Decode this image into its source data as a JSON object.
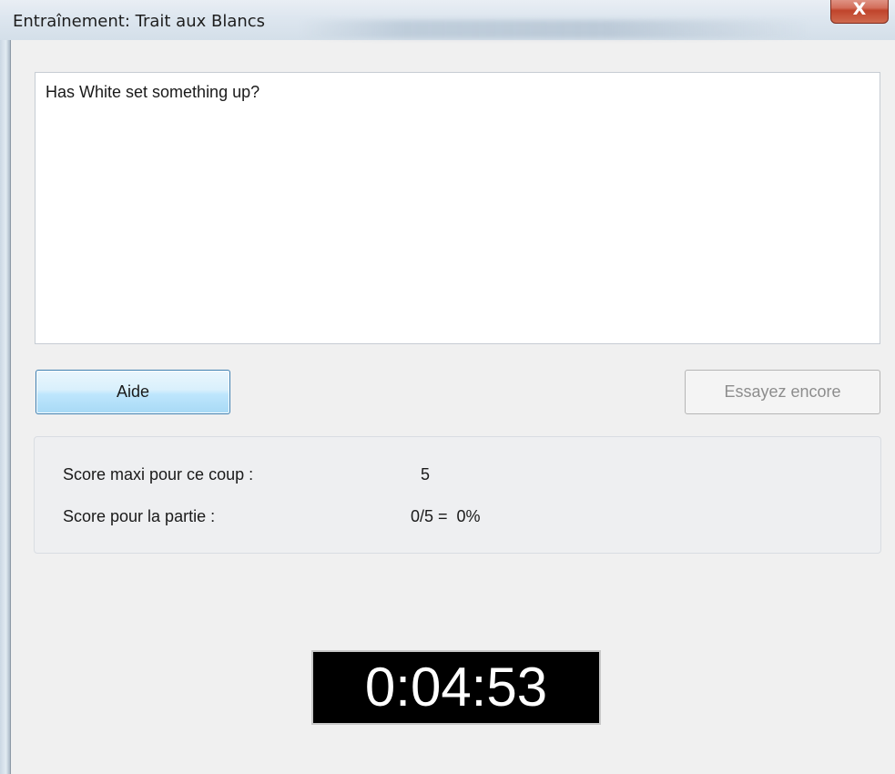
{
  "window": {
    "title": "Entraînement: Trait aux Blancs",
    "close_glyph": "X"
  },
  "message": {
    "text": "Has White set something up?"
  },
  "buttons": {
    "help_label": "Aide",
    "retry_label": "Essayez encore"
  },
  "score": {
    "max_move_label": "Score maxi pour ce coup :",
    "max_move_value": "5",
    "game_label": "Score pour la partie :",
    "game_value": "0/5 =  0%"
  },
  "timer": {
    "value": "0:04:53"
  },
  "colors": {
    "timer_background": "#000000",
    "timer_text": "#ffffff",
    "close_button": "#c0442b",
    "help_button_border": "#3c7fb1"
  }
}
